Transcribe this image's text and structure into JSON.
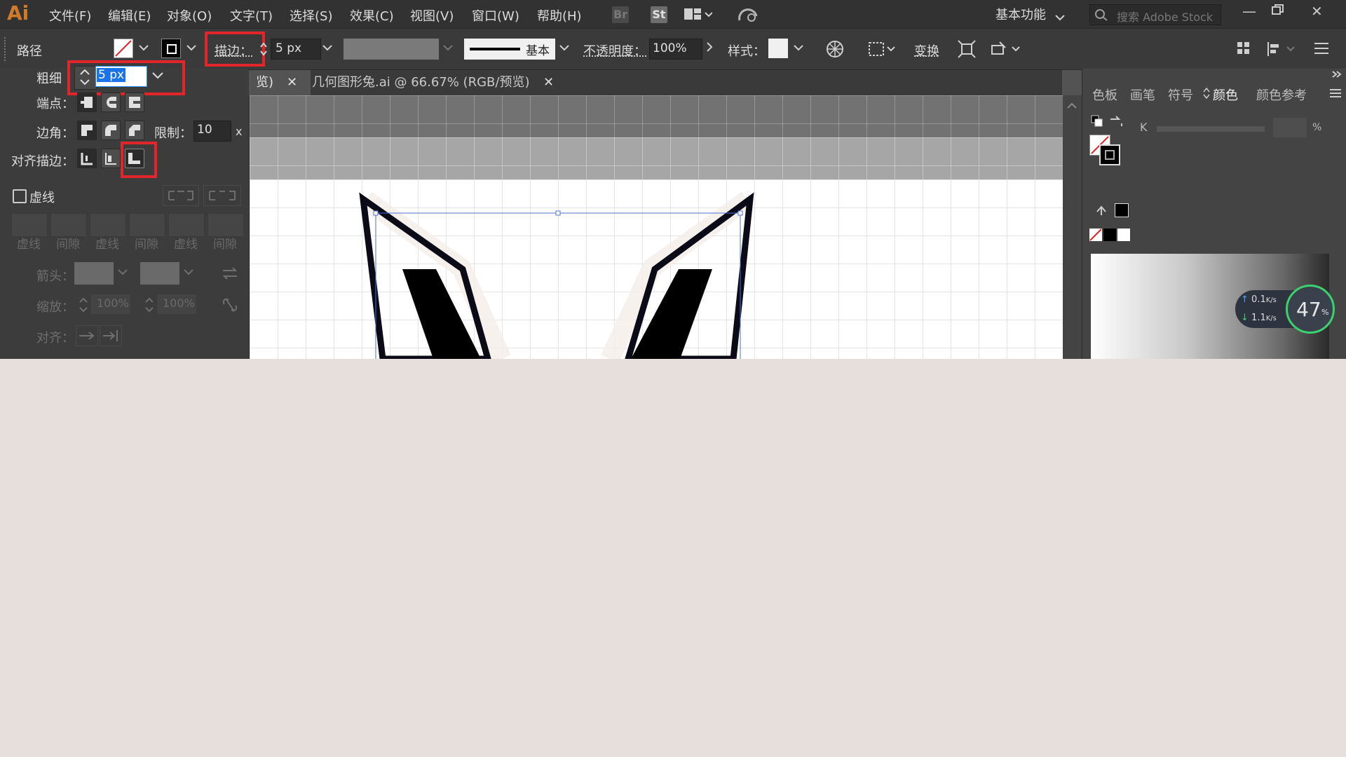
{
  "app": {
    "logo": "Ai",
    "menu": [
      "文件(F)",
      "编辑(E)",
      "对象(O)",
      "文字(T)",
      "选择(S)",
      "效果(C)",
      "视图(V)",
      "窗口(W)",
      "帮助(H)"
    ],
    "br_label": "Br",
    "st_label": "St",
    "workspace": "基本功能",
    "search_placeholder": "搜索 Adobe Stock"
  },
  "controlbar": {
    "selection_type": "路径",
    "stroke_label": "描边：",
    "stroke_value": "5 px",
    "brush_label": "基本",
    "opacity_label": "不透明度：",
    "opacity_value": "100%",
    "style_label": "样式：",
    "transform_label": "变换"
  },
  "stroke_panel": {
    "weight_label": "粗细",
    "weight_value": "5 px",
    "cap_label": "端点：",
    "corner_label": "边角：",
    "limit_label": "限制：",
    "limit_value": "10",
    "limit_unit": "x",
    "align_label": "对齐描边：",
    "dashed_label": "虚线",
    "dash_labels": [
      "虚线",
      "间隙",
      "虚线",
      "间隙",
      "虚线",
      "间隙"
    ],
    "arrow_label": "箭头：",
    "scale_label": "缩放：",
    "scale_value_1": "100%",
    "scale_value_2": "100%",
    "align2_label": "对齐："
  },
  "tabs": {
    "tab1": "览)",
    "tab2": "几何图形兔.ai @ 66.67% (RGB/预览)"
  },
  "right_panel": {
    "tabs": [
      "色板",
      "画笔",
      "符号",
      "颜色",
      "颜色参考"
    ],
    "active_tab": "颜色",
    "k_label": "K",
    "percent": "%"
  },
  "speed_widget": {
    "up": "0.1",
    "down": "1.1",
    "unit": "K/s",
    "percent": "47",
    "percent_sign": "%"
  },
  "colors": {
    "accent_red": "#e1262b",
    "selection_blue": "#1a73e8",
    "logo_orange": "#d07a2a"
  }
}
